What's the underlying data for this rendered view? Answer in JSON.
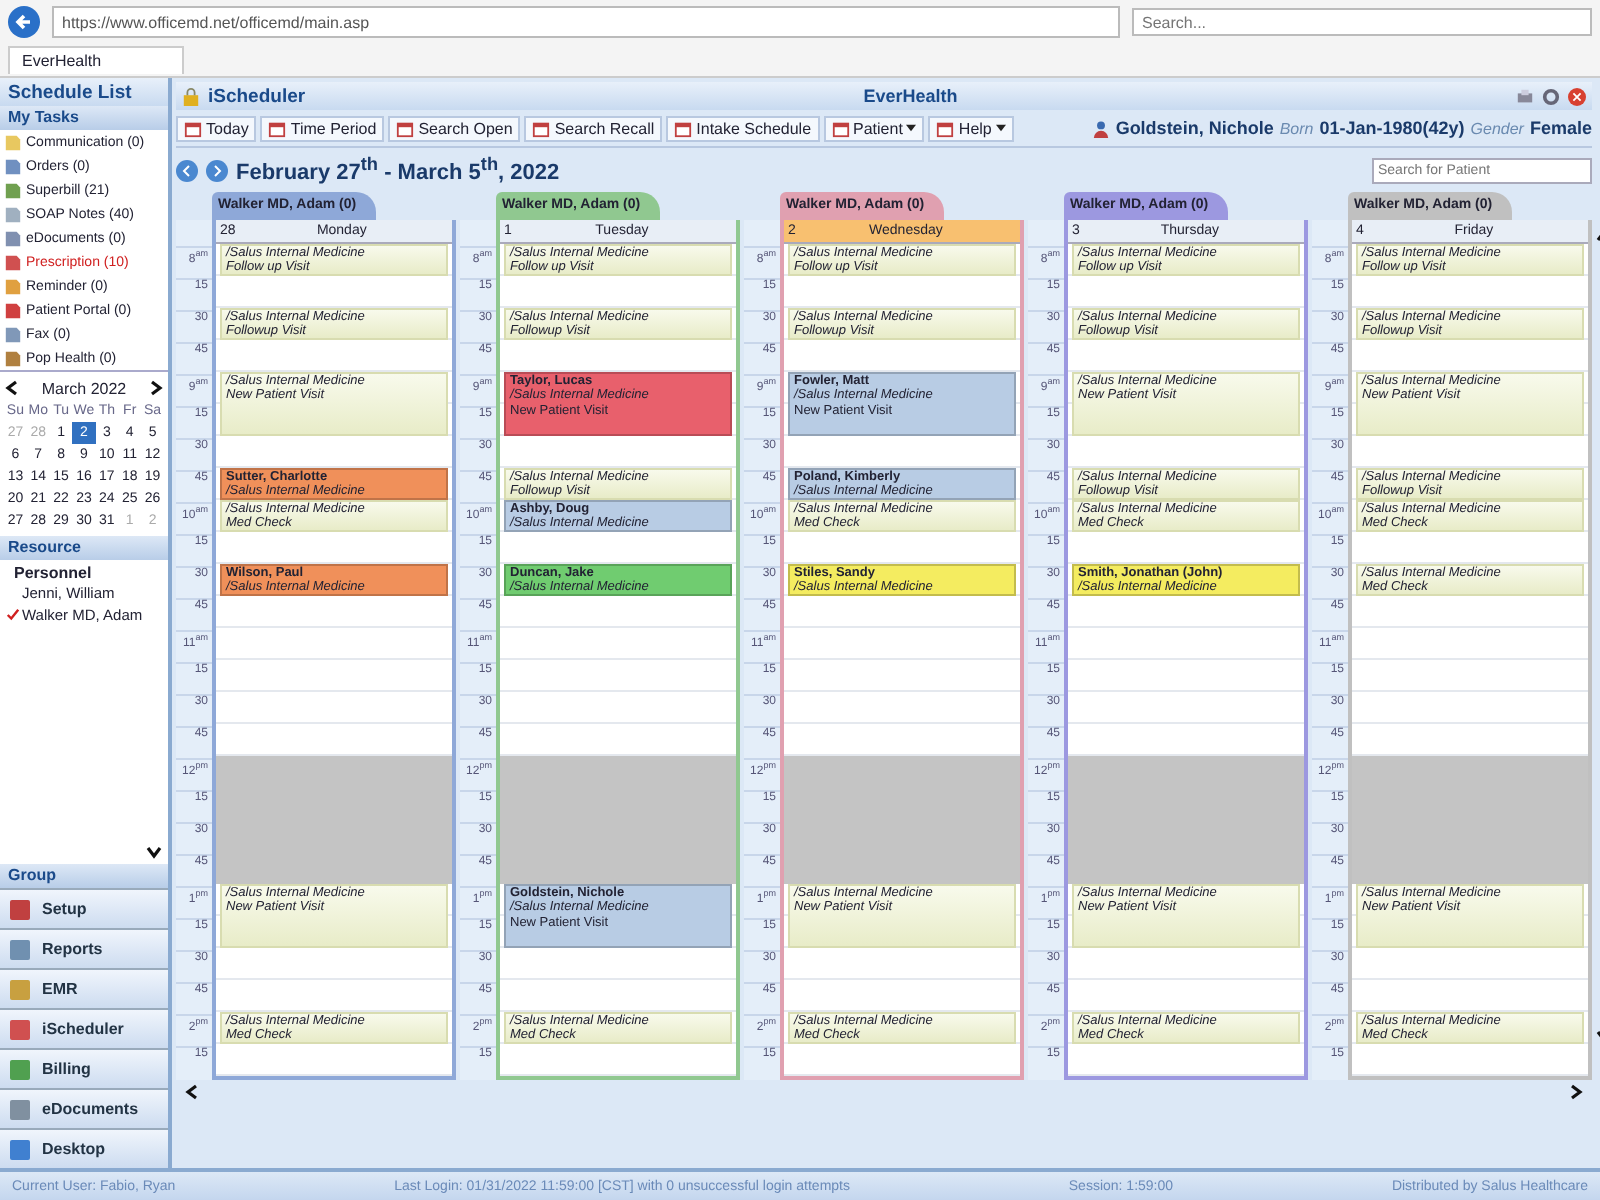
{
  "browser": {
    "url": "https://www.officemd.net/officemd/main.asp",
    "search": {
      "placeholder": "Search..."
    },
    "tab": "EverHealth"
  },
  "sidebar": {
    "title": "Schedule List",
    "tasks_header": "My Tasks",
    "tasks": [
      {
        "label": "Communication (0)",
        "color": "#e8c860",
        "alert": false
      },
      {
        "label": "Orders (0)",
        "color": "#7090c0",
        "alert": false
      },
      {
        "label": "Superbill (21)",
        "color": "#70a050",
        "alert": false
      },
      {
        "label": "SOAP Notes (40)",
        "color": "#a0b0c0",
        "alert": false
      },
      {
        "label": "eDocuments (0)",
        "color": "#8090b0",
        "alert": false
      },
      {
        "label": "Prescription (10)",
        "color": "#d05050",
        "alert": true
      },
      {
        "label": "Reminder (0)",
        "color": "#e0a040",
        "alert": false
      },
      {
        "label": "Patient Portal (0)",
        "color": "#d04040",
        "alert": false
      },
      {
        "label": "Fax (0)",
        "color": "#8098b8",
        "alert": false
      },
      {
        "label": "Pop Health (0)",
        "color": "#b08040",
        "alert": false
      }
    ],
    "calendar": {
      "month": "March 2022",
      "weekdays": [
        "Su",
        "Mo",
        "Tu",
        "We",
        "Th",
        "Fr",
        "Sa"
      ],
      "weeks": [
        [
          {
            "d": "27",
            "muted": true,
            "selected": false
          },
          {
            "d": "28",
            "muted": true,
            "selected": false
          },
          {
            "d": "1",
            "muted": false,
            "selected": false
          },
          {
            "d": "2",
            "muted": false,
            "selected": true
          },
          {
            "d": "3",
            "muted": false,
            "selected": false
          },
          {
            "d": "4",
            "muted": false,
            "selected": false
          },
          {
            "d": "5",
            "muted": false,
            "selected": false
          }
        ],
        [
          {
            "d": "6",
            "muted": false,
            "selected": false
          },
          {
            "d": "7",
            "muted": false,
            "selected": false
          },
          {
            "d": "8",
            "muted": false,
            "selected": false
          },
          {
            "d": "9",
            "muted": false,
            "selected": false
          },
          {
            "d": "10",
            "muted": false,
            "selected": false
          },
          {
            "d": "11",
            "muted": false,
            "selected": false
          },
          {
            "d": "12",
            "muted": false,
            "selected": false
          }
        ],
        [
          {
            "d": "13",
            "muted": false,
            "selected": false
          },
          {
            "d": "14",
            "muted": false,
            "selected": false
          },
          {
            "d": "15",
            "muted": false,
            "selected": false
          },
          {
            "d": "16",
            "muted": false,
            "selected": false
          },
          {
            "d": "17",
            "muted": false,
            "selected": false
          },
          {
            "d": "18",
            "muted": false,
            "selected": false
          },
          {
            "d": "19",
            "muted": false,
            "selected": false
          }
        ],
        [
          {
            "d": "20",
            "muted": false,
            "selected": false
          },
          {
            "d": "21",
            "muted": false,
            "selected": false
          },
          {
            "d": "22",
            "muted": false,
            "selected": false
          },
          {
            "d": "23",
            "muted": false,
            "selected": false
          },
          {
            "d": "24",
            "muted": false,
            "selected": false
          },
          {
            "d": "25",
            "muted": false,
            "selected": false
          },
          {
            "d": "26",
            "muted": false,
            "selected": false
          }
        ],
        [
          {
            "d": "27",
            "muted": false,
            "selected": false
          },
          {
            "d": "28",
            "muted": false,
            "selected": false
          },
          {
            "d": "29",
            "muted": false,
            "selected": false
          },
          {
            "d": "30",
            "muted": false,
            "selected": false
          },
          {
            "d": "31",
            "muted": false,
            "selected": false
          },
          {
            "d": "1",
            "muted": true,
            "selected": false
          },
          {
            "d": "2",
            "muted": true,
            "selected": false
          }
        ]
      ]
    },
    "resources_header": "Resource",
    "resources": [
      {
        "kind": "heading",
        "label": "Personnel"
      },
      {
        "kind": "resource",
        "label": "Jenni, William",
        "checked": false
      },
      {
        "kind": "resource",
        "label": "Walker MD, Adam",
        "checked": true
      }
    ],
    "group_header": "Group",
    "nav": [
      {
        "label": "Setup",
        "color": "#c04040"
      },
      {
        "label": "Reports",
        "color": "#7090b0"
      },
      {
        "label": "EMR",
        "color": "#c8a040"
      },
      {
        "label": "iScheduler",
        "color": "#d05050"
      },
      {
        "label": "Billing",
        "color": "#50a050"
      },
      {
        "label": "eDocuments",
        "color": "#8090a0"
      },
      {
        "label": "Desktop",
        "color": "#4080d0"
      }
    ]
  },
  "header": {
    "module": "iScheduler",
    "brand": "EverHealth"
  },
  "toolbar": [
    {
      "label": "Today",
      "dropdown": false
    },
    {
      "label": "Time Period",
      "dropdown": false
    },
    {
      "label": "Search Open",
      "dropdown": false
    },
    {
      "label": "Search Recall",
      "dropdown": false
    },
    {
      "label": "Intake Schedule",
      "dropdown": false
    },
    {
      "label": "Patient",
      "dropdown": true
    },
    {
      "label": "Help",
      "dropdown": true
    }
  ],
  "patient": {
    "name": "Goldstein, Nichole",
    "born_label": "Born",
    "born": "01-Jan-1980(42y)",
    "gender_label": "Gender",
    "gender": "Female"
  },
  "range_title": "February 27$^{th}$ - March 5$^{th}$, 2022",
  "patient_search": {
    "placeholder": "Search for Patient"
  },
  "days": [
    {
      "provider": "Walker MD, Adam (0)",
      "color": "#8ea8d8",
      "date": "28",
      "weekday": "Monday",
      "today": false,
      "rows": [
        {
          "time": "8$^{am}$",
          "blocked": false,
          "appointment": {
            "kind": "open",
            "tall": false,
            "location": "/Salus Internal Medicine",
            "visit": "Follow up Visit"
          }
        },
        {
          "time": "15",
          "blocked": false
        },
        {
          "time": "30",
          "blocked": false,
          "appointment": {
            "kind": "open",
            "tall": false,
            "location": "/Salus Internal Medicine",
            "visit": "Followup Visit"
          }
        },
        {
          "time": "45",
          "blocked": false
        },
        {
          "time": "9$^{am}$",
          "blocked": false,
          "appointment": {
            "kind": "open",
            "tall": true,
            "location": "/Salus Internal Medicine",
            "visit": "New Patient Visit"
          }
        },
        {
          "time": "15",
          "blocked": false
        },
        {
          "time": "30",
          "blocked": false
        },
        {
          "time": "45",
          "blocked": false,
          "appointment": {
            "kind": "booked",
            "tall": false,
            "patient": "Sutter, Charlotte",
            "location": "/Salus Internal Medicine",
            "color": "#f0905a"
          }
        },
        {
          "time": "10$^{am}$",
          "blocked": false,
          "appointment": {
            "kind": "open",
            "tall": false,
            "location": "/Salus Internal Medicine",
            "visit": "Med Check"
          }
        },
        {
          "time": "15",
          "blocked": false
        },
        {
          "time": "30",
          "blocked": false,
          "appointment": {
            "kind": "booked",
            "tall": false,
            "patient": "Wilson, Paul",
            "location": "/Salus Internal Medicine",
            "color": "#f0905a"
          }
        },
        {
          "time": "45",
          "blocked": false
        },
        {
          "time": "11$^{am}$",
          "blocked": false
        },
        {
          "time": "15",
          "blocked": false
        },
        {
          "time": "30",
          "blocked": false
        },
        {
          "time": "45",
          "blocked": false
        },
        {
          "time": "12$^{pm}$",
          "blocked": true
        },
        {
          "time": "15",
          "blocked": true
        },
        {
          "time": "30",
          "blocked": true
        },
        {
          "time": "45",
          "blocked": true
        },
        {
          "time": "1$^{pm}$",
          "blocked": false,
          "appointment": {
            "kind": "open",
            "tall": true,
            "location": "/Salus Internal Medicine",
            "visit": "New Patient Visit"
          }
        },
        {
          "time": "15",
          "blocked": false
        },
        {
          "time": "30",
          "blocked": false
        },
        {
          "time": "45",
          "blocked": false
        },
        {
          "time": "2$^{pm}$",
          "blocked": false,
          "appointment": {
            "kind": "open",
            "tall": false,
            "location": "/Salus Internal Medicine",
            "visit": "Med Check"
          }
        },
        {
          "time": "15",
          "blocked": false
        }
      ]
    },
    {
      "provider": "Walker MD, Adam (0)",
      "color": "#90c890",
      "date": "1",
      "weekday": "Tuesday",
      "today": false,
      "rows": [
        {
          "time": "8$^{am}$",
          "blocked": false,
          "appointment": {
            "kind": "open",
            "tall": false,
            "location": "/Salus Internal Medicine",
            "visit": "Follow up Visit"
          }
        },
        {
          "time": "15",
          "blocked": false
        },
        {
          "time": "30",
          "blocked": false,
          "appointment": {
            "kind": "open",
            "tall": false,
            "location": "/Salus Internal Medicine",
            "visit": "Followup Visit"
          }
        },
        {
          "time": "45",
          "blocked": false
        },
        {
          "time": "9$^{am}$",
          "blocked": false,
          "appointment": {
            "kind": "booked",
            "tall": true,
            "patient": "Taylor, Lucas",
            "location": "/Salus Internal Medicine",
            "visit": "New Patient Visit",
            "color": "#e8606c"
          }
        },
        {
          "time": "15",
          "blocked": false
        },
        {
          "time": "30",
          "blocked": false
        },
        {
          "time": "45",
          "blocked": false,
          "appointment": {
            "kind": "open",
            "tall": false,
            "location": "/Salus Internal Medicine",
            "visit": "Followup Visit"
          }
        },
        {
          "time": "10$^{am}$",
          "blocked": false,
          "appointment": {
            "kind": "booked",
            "tall": false,
            "patient": "Ashby, Doug",
            "location": "/Salus Internal Medicine",
            "color": "#b8cce4"
          }
        },
        {
          "time": "15",
          "blocked": false
        },
        {
          "time": "30",
          "blocked": false,
          "appointment": {
            "kind": "booked",
            "tall": false,
            "patient": "Duncan, Jake",
            "location": "/Salus Internal Medicine",
            "color": "#70cc70"
          }
        },
        {
          "time": "45",
          "blocked": false
        },
        {
          "time": "11$^{am}$",
          "blocked": false
        },
        {
          "time": "15",
          "blocked": false
        },
        {
          "time": "30",
          "blocked": false
        },
        {
          "time": "45",
          "blocked": false
        },
        {
          "time": "12$^{pm}$",
          "blocked": true
        },
        {
          "time": "15",
          "blocked": true
        },
        {
          "time": "30",
          "blocked": true
        },
        {
          "time": "45",
          "blocked": true
        },
        {
          "time": "1$^{pm}$",
          "blocked": false,
          "appointment": {
            "kind": "booked",
            "tall": true,
            "patient": "Goldstein, Nichole",
            "location": "/Salus Internal Medicine",
            "visit": "New Patient Visit",
            "color": "#b8cce4"
          }
        },
        {
          "time": "15",
          "blocked": false
        },
        {
          "time": "30",
          "blocked": false
        },
        {
          "time": "45",
          "blocked": false
        },
        {
          "time": "2$^{pm}$",
          "blocked": false,
          "appointment": {
            "kind": "open",
            "tall": false,
            "location": "/Salus Internal Medicine",
            "visit": "Med Check"
          }
        },
        {
          "time": "15",
          "blocked": false
        }
      ]
    },
    {
      "provider": "Walker MD, Adam (0)",
      "color": "#e0a0b0",
      "date": "2",
      "weekday": "Wednesday",
      "today": true,
      "rows": [
        {
          "time": "8$^{am}$",
          "blocked": false,
          "appointment": {
            "kind": "open",
            "tall": false,
            "location": "/Salus Internal Medicine",
            "visit": "Follow up Visit"
          }
        },
        {
          "time": "15",
          "blocked": false
        },
        {
          "time": "30",
          "blocked": false,
          "appointment": {
            "kind": "open",
            "tall": false,
            "location": "/Salus Internal Medicine",
            "visit": "Followup Visit"
          }
        },
        {
          "time": "45",
          "blocked": false
        },
        {
          "time": "9$^{am}$",
          "blocked": false,
          "appointment": {
            "kind": "booked",
            "tall": true,
            "patient": "Fowler, Matt",
            "location": "/Salus Internal Medicine",
            "visit": "New Patient Visit",
            "color": "#b8cce4"
          }
        },
        {
          "time": "15",
          "blocked": false
        },
        {
          "time": "30",
          "blocked": false
        },
        {
          "time": "45",
          "blocked": false,
          "appointment": {
            "kind": "booked",
            "tall": false,
            "patient": "Poland, Kimberly",
            "location": "/Salus Internal Medicine",
            "color": "#b8cce4"
          }
        },
        {
          "time": "10$^{am}$",
          "blocked": false,
          "appointment": {
            "kind": "open",
            "tall": false,
            "location": "/Salus Internal Medicine",
            "visit": "Med Check"
          }
        },
        {
          "time": "15",
          "blocked": false
        },
        {
          "time": "30",
          "blocked": false,
          "appointment": {
            "kind": "booked",
            "tall": false,
            "patient": "Stiles, Sandy",
            "location": "/Salus Internal Medicine",
            "color": "#f4ec60"
          }
        },
        {
          "time": "45",
          "blocked": false
        },
        {
          "time": "11$^{am}$",
          "blocked": false
        },
        {
          "time": "15",
          "blocked": false
        },
        {
          "time": "30",
          "blocked": false
        },
        {
          "time": "45",
          "blocked": false
        },
        {
          "time": "12$^{pm}$",
          "blocked": true
        },
        {
          "time": "15",
          "blocked": true
        },
        {
          "time": "30",
          "blocked": true
        },
        {
          "time": "45",
          "blocked": true
        },
        {
          "time": "1$^{pm}$",
          "blocked": false,
          "appointment": {
            "kind": "open",
            "tall": true,
            "location": "/Salus Internal Medicine",
            "visit": "New Patient Visit"
          }
        },
        {
          "time": "15",
          "blocked": false
        },
        {
          "time": "30",
          "blocked": false
        },
        {
          "time": "45",
          "blocked": false
        },
        {
          "time": "2$^{pm}$",
          "blocked": false,
          "appointment": {
            "kind": "open",
            "tall": false,
            "location": "/Salus Internal Medicine",
            "visit": "Med Check"
          }
        },
        {
          "time": "15",
          "blocked": false
        }
      ]
    },
    {
      "provider": "Walker MD, Adam (0)",
      "color": "#9c98e0",
      "date": "3",
      "weekday": "Thursday",
      "today": false,
      "rows": [
        {
          "time": "8$^{am}$",
          "blocked": false,
          "appointment": {
            "kind": "open",
            "tall": false,
            "location": "/Salus Internal Medicine",
            "visit": "Follow up Visit"
          }
        },
        {
          "time": "15",
          "blocked": false
        },
        {
          "time": "30",
          "blocked": false,
          "appointment": {
            "kind": "open",
            "tall": false,
            "location": "/Salus Internal Medicine",
            "visit": "Followup Visit"
          }
        },
        {
          "time": "45",
          "blocked": false
        },
        {
          "time": "9$^{am}$",
          "blocked": false,
          "appointment": {
            "kind": "open",
            "tall": true,
            "location": "/Salus Internal Medicine",
            "visit": "New Patient Visit"
          }
        },
        {
          "time": "15",
          "blocked": false
        },
        {
          "time": "30",
          "blocked": false
        },
        {
          "time": "45",
          "blocked": false,
          "appointment": {
            "kind": "open",
            "tall": false,
            "location": "/Salus Internal Medicine",
            "visit": "Followup Visit"
          }
        },
        {
          "time": "10$^{am}$",
          "blocked": false,
          "appointment": {
            "kind": "open",
            "tall": false,
            "location": "/Salus Internal Medicine",
            "visit": "Med Check"
          }
        },
        {
          "time": "15",
          "blocked": false
        },
        {
          "time": "30",
          "blocked": false,
          "appointment": {
            "kind": "booked",
            "tall": false,
            "patient": "Smith, Jonathan (John)",
            "location": "/Salus Internal Medicine",
            "color": "#f4ec60"
          }
        },
        {
          "time": "45",
          "blocked": false
        },
        {
          "time": "11$^{am}$",
          "blocked": false
        },
        {
          "time": "15",
          "blocked": false
        },
        {
          "time": "30",
          "blocked": false
        },
        {
          "time": "45",
          "blocked": false
        },
        {
          "time": "12$^{pm}$",
          "blocked": true
        },
        {
          "time": "15",
          "blocked": true
        },
        {
          "time": "30",
          "blocked": true
        },
        {
          "time": "45",
          "blocked": true
        },
        {
          "time": "1$^{pm}$",
          "blocked": false,
          "appointment": {
            "kind": "open",
            "tall": true,
            "location": "/Salus Internal Medicine",
            "visit": "New Patient Visit"
          }
        },
        {
          "time": "15",
          "blocked": false
        },
        {
          "time": "30",
          "blocked": false
        },
        {
          "time": "45",
          "blocked": false
        },
        {
          "time": "2$^{pm}$",
          "blocked": false,
          "appointment": {
            "kind": "open",
            "tall": false,
            "location": "/Salus Internal Medicine",
            "visit": "Med Check"
          }
        },
        {
          "time": "15",
          "blocked": false
        }
      ]
    },
    {
      "provider": "Walker MD, Adam (0)",
      "color": "#c0c0c0",
      "date": "4",
      "weekday": "Friday",
      "today": false,
      "rows": [
        {
          "time": "8$^{am}$",
          "blocked": false,
          "appointment": {
            "kind": "open",
            "tall": false,
            "location": "/Salus Internal Medicine",
            "visit": "Follow up Visit"
          }
        },
        {
          "time": "15",
          "blocked": false
        },
        {
          "time": "30",
          "blocked": false,
          "appointment": {
            "kind": "open",
            "tall": false,
            "location": "/Salus Internal Medicine",
            "visit": "Followup Visit"
          }
        },
        {
          "time": "45",
          "blocked": false
        },
        {
          "time": "9$^{am}$",
          "blocked": false,
          "appointment": {
            "kind": "open",
            "tall": true,
            "location": "/Salus Internal Medicine",
            "visit": "New Patient Visit"
          }
        },
        {
          "time": "15",
          "blocked": false
        },
        {
          "time": "30",
          "blocked": false
        },
        {
          "time": "45",
          "blocked": false,
          "appointment": {
            "kind": "open",
            "tall": false,
            "location": "/Salus Internal Medicine",
            "visit": "Followup Visit"
          }
        },
        {
          "time": "10$^{am}$",
          "blocked": false,
          "appointment": {
            "kind": "open",
            "tall": false,
            "location": "/Salus Internal Medicine",
            "visit": "Med Check"
          }
        },
        {
          "time": "15",
          "blocked": false
        },
        {
          "time": "30",
          "blocked": false,
          "appointment": {
            "kind": "open",
            "tall": false,
            "location": "/Salus Internal Medicine",
            "visit": "Med Check"
          }
        },
        {
          "time": "45",
          "blocked": false
        },
        {
          "time": "11$^{am}$",
          "blocked": false
        },
        {
          "time": "15",
          "blocked": false
        },
        {
          "time": "30",
          "blocked": false
        },
        {
          "time": "45",
          "blocked": false
        },
        {
          "time": "12$^{pm}$",
          "blocked": true
        },
        {
          "time": "15",
          "blocked": true
        },
        {
          "time": "30",
          "blocked": true
        },
        {
          "time": "45",
          "blocked": true
        },
        {
          "time": "1$^{pm}$",
          "blocked": false,
          "appointment": {
            "kind": "open",
            "tall": true,
            "location": "/Salus Internal Medicine",
            "visit": "New Patient Visit"
          }
        },
        {
          "time": "15",
          "blocked": false
        },
        {
          "time": "30",
          "blocked": false
        },
        {
          "time": "45",
          "blocked": false
        },
        {
          "time": "2$^{pm}$",
          "blocked": false,
          "appointment": {
            "kind": "open",
            "tall": false,
            "location": "/Salus Internal Medicine",
            "visit": "Med Check"
          }
        },
        {
          "time": "15",
          "blocked": false
        }
      ]
    }
  ],
  "status_bar": {
    "user": "Current User: Fabio, Ryan",
    "last_login": "Last Login: 01/31/2022 11:59:00 [CST] with 0 unsuccessful login attempts",
    "session": "Session: 1:59:00",
    "distributor": "Distributed by Salus Healthcare"
  }
}
